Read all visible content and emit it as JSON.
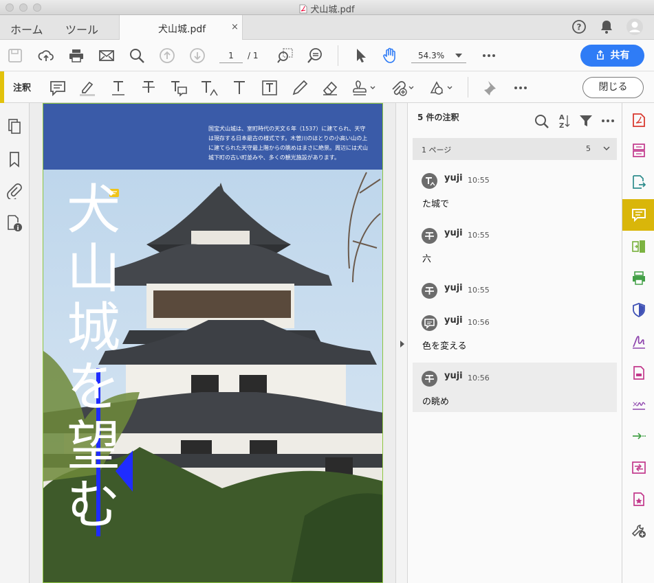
{
  "window": {
    "title": "犬山城.pdf"
  },
  "tabs": {
    "home": "ホーム",
    "tools": "ツール",
    "document": "犬山城.pdf",
    "close_glyph": "×"
  },
  "toolbar": {
    "page_current": "1",
    "page_total": "/ 1",
    "zoom": "54.3%",
    "share_label": "共有",
    "icons": [
      "save-icon",
      "upload-cloud-icon",
      "print-icon",
      "email-icon",
      "search-icon",
      "prev-page-icon",
      "next-page-icon",
      "marquee-zoom-icon",
      "zoom-tool-icon",
      "select-pointer-icon",
      "hand-tool-icon",
      "zoom-dropdown-icon",
      "more-icon"
    ]
  },
  "annotation_bar": {
    "label": "注釈",
    "close_label": "閉じる",
    "tools": [
      "sticky-note-icon",
      "highlight-icon",
      "underline-text-icon",
      "strikethrough-text-icon",
      "replace-text-icon",
      "insert-text-icon",
      "add-text-icon",
      "text-box-icon",
      "pencil-icon",
      "eraser-icon",
      "stamp-icon",
      "attach-file-icon",
      "shapes-icon",
      "pin-icon",
      "more-icon"
    ]
  },
  "document": {
    "header_text": "国宝犬山城は、室町時代の天文６年（1537）に建てられ、天守は現存する日本最古の様式です。木曽川のほとりの小高い山の上に建てられた天守最上階からの眺めはまさに絶景。周辺には犬山城下町の古い町並みや、多くの観光施設があります。",
    "title_vertical": [
      "犬",
      "山",
      "城",
      "を",
      "望",
      "む"
    ],
    "header_color": "#3a5ba8",
    "annotation_color": "#1f2cff"
  },
  "comments_panel": {
    "title": "5 件の注釈",
    "group_label": "1 ページ",
    "group_count": "5",
    "comments": [
      {
        "author": "yuji",
        "time": "10:55",
        "text": "た城で",
        "icon": "insert-text-icon"
      },
      {
        "author": "yuji",
        "time": "10:55",
        "text": "六",
        "icon": "strikethrough-text-icon"
      },
      {
        "author": "yuji",
        "time": "10:55",
        "text": "",
        "icon": "strikethrough-text-icon"
      },
      {
        "author": "yuji",
        "time": "10:56",
        "text": "色を変える",
        "icon": "comment-icon"
      },
      {
        "author": "yuji",
        "time": "10:56",
        "text": "の眺め",
        "icon": "strikethrough-text-icon"
      }
    ]
  },
  "right_rail": {
    "tools": [
      "create-pdf-icon",
      "organize-pages-icon",
      "export-pdf-icon",
      "comment-tool-icon",
      "compare-icon",
      "print-production-icon",
      "protect-icon",
      "fill-sign-icon",
      "edit-pdf-icon",
      "send-for-signature-icon",
      "send-track-icon",
      "combine-icon",
      "rich-media-icon",
      "more-tools-icon"
    ],
    "active_color": "#d9b60a"
  }
}
